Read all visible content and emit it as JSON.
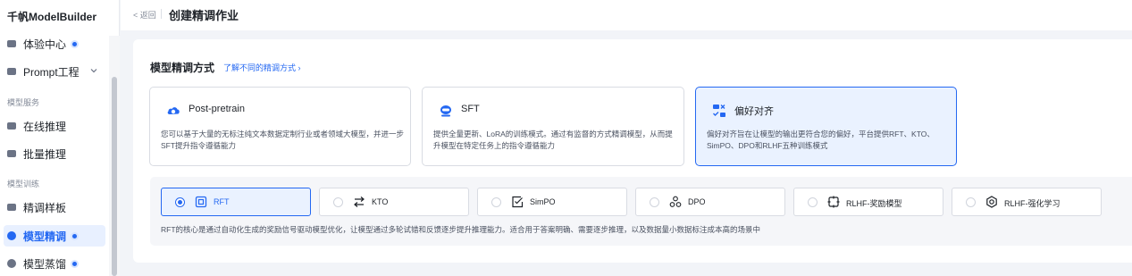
{
  "sidebar": {
    "brand": "千帆ModelBuilder",
    "items": [
      {
        "label": "体验中心"
      },
      {
        "label": "Prompt工程"
      },
      {
        "label": "在线推理"
      },
      {
        "label": "批量推理"
      },
      {
        "label": "精调样板"
      },
      {
        "label": "模型精调"
      },
      {
        "label": "模型蒸馏"
      }
    ],
    "sections": [
      "模型服务",
      "模型训练"
    ]
  },
  "header": {
    "back_label": "< 返回",
    "title": "创建精调作业"
  },
  "main": {
    "section_title": "模型精调方式",
    "learn_link": "了解不同的精调方式 ›",
    "methods": [
      {
        "name": "Post-pretrain",
        "desc": "您可以基于大量的无标注纯文本数据定制行业或者领域大模型，并进一步SFT提升指令遵循能力",
        "icon": "cloud-icon"
      },
      {
        "name": "SFT",
        "desc": "提供全量更新、LoRA的训练模式。通过有监督的方式精调模型，从而提升模型在特定任务上的指令遵循能力",
        "icon": "robot-icon"
      },
      {
        "name": "偏好对齐",
        "desc": "偏好对齐旨在让模型的输出更符合您的偏好，平台提供RFT、KTO、SimPO、DPO和RLHF五种训练模式",
        "icon": "align-icon"
      }
    ],
    "algorithms": [
      {
        "name": "RFT",
        "icon": "rft-icon"
      },
      {
        "name": "KTO",
        "icon": "kto-icon"
      },
      {
        "name": "SimPO",
        "icon": "simpo-icon"
      },
      {
        "name": "DPO",
        "icon": "dpo-icon"
      },
      {
        "name": "RLHF-奖励模型",
        "icon": "reward-model-icon"
      },
      {
        "name": "RLHF-强化学习",
        "icon": "reinforcement-icon"
      }
    ],
    "algorithm_desc": "RFT的核心是通过自动化生成的奖励信号驱动模型优化，让模型通过多轮试错和反馈逐步提升推理能力。适合用于答案明确、需要逐步推理，以及数据量小数据标注成本高的场景中"
  },
  "colors": {
    "accent": "#2468f2",
    "selected_bg": "#eaf2ff",
    "page_bg": "#f2f4f8"
  }
}
